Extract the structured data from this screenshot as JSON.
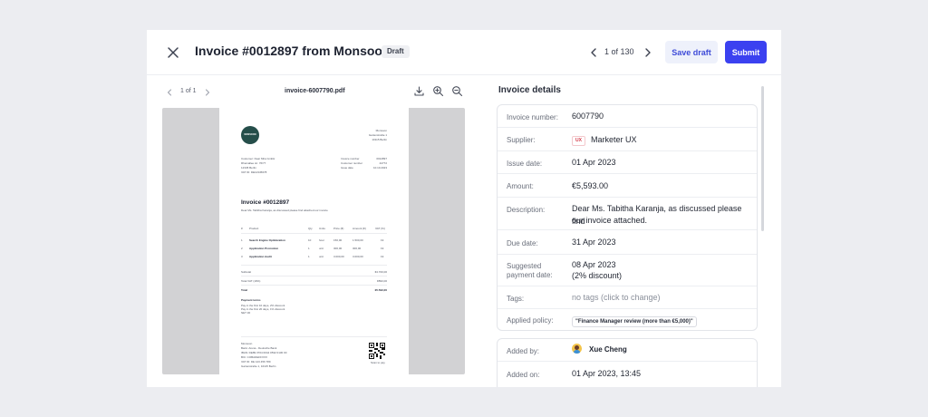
{
  "header": {
    "title": "Invoice #0012897 from Monsoon",
    "badge": "Draft",
    "pager": "1 of 130",
    "save_label": "Save draft",
    "submit_label": "Submit"
  },
  "viewer": {
    "pages": "1 of 1",
    "filename": "invoice-6007790.pdf"
  },
  "document": {
    "logo_text": "MONSOON",
    "sender": [
      "Monsoon",
      "Gartenstraße 1",
      "10115 Berlin"
    ],
    "customer_lines": [
      "Customer: Dear Mira GmbH",
      "Rheinallee str. 76/77",
      "12345 Berlin",
      "VAT ID: DE12345678"
    ],
    "meta_labels": [
      "Invoice number",
      "Customer number",
      "Issue date"
    ],
    "meta_values": [
      "0012897",
      "42772",
      "10.10.2023"
    ],
    "title": "Invoice #0012897",
    "intro": "Dear Ms. Tabitha Karanja, as discussed please find attached our invoice",
    "columns": [
      "#",
      "Product",
      "Qty",
      "Units",
      "Price (€)",
      "Amount (€)",
      "VAT (%)"
    ],
    "items": [
      [
        "1",
        "Search Engine Optimization",
        "10",
        "hour",
        "150,00",
        "1.500,00",
        "19"
      ],
      [
        "2",
        "Application Promotion",
        "1",
        "unit",
        "300,00",
        "300,00",
        "19"
      ],
      [
        "3",
        "Application Audit",
        "1",
        "unit",
        "3.000,00",
        "3.000,00",
        "19"
      ]
    ],
    "totals": [
      [
        "Subtotal",
        "€4.700,00"
      ],
      [
        "Total VAT (19%)",
        "€893,00"
      ],
      [
        "Total",
        "€5.593,00"
      ]
    ],
    "payment_title": "Payment terms",
    "payment_lines": [
      "Pay in the first 10 days, 2% discount",
      "Pay in the first 20 days, 1% discount",
      "NET 30"
    ],
    "footer_lines": [
      "Monsoon",
      "Bank: Arena - Deutsche Bank",
      "IBAN: DE89 3704 0044 0532 0130 00",
      "BIC: COBADEFFXXX",
      "VAT ID: DE 123 456 789",
      "Gartenstraße 1, 10115 Berlin"
    ],
    "qr_caption": "Scan to pay"
  },
  "details": {
    "title": "Invoice details",
    "invoice_number_label": "Invoice number:",
    "invoice_number": "6007790",
    "supplier_label": "Supplier:",
    "supplier_badge": "UX",
    "supplier": "Marketer UX",
    "issue_date_label": "Issue date:",
    "issue_date": "01 Apr 2023",
    "amount_label": "Amount:",
    "amount": "€5,593.00",
    "description_label": "Description:",
    "description_1": "Dear Ms. Tabitha Karanja, as discussed please find",
    "description_2": "our invoice attached.",
    "due_date_label": "Due date:",
    "due_date": "31 Apr 2023",
    "suggested_label_1": "Suggested",
    "suggested_label_2": "payment date:",
    "suggested_1": "08 Apr 2023",
    "suggested_2": "(2% discount)",
    "tags_label": "Tags:",
    "tags": "no tags (click to change)",
    "policy_label": "Applied policy:",
    "policy": "\"Finance Manager review (more than €5,000)\"",
    "added_by_label": "Added by:",
    "added_by": "Xue Cheng",
    "added_on_label": "Added on:",
    "added_on": "01 Apr 2023, 13:45"
  },
  "colors": {
    "accent": "#3b41f0",
    "draft_bg": "#eef1fb",
    "page_bg": "#ecedf1",
    "logo": "#254e4a"
  },
  "icons": [
    "close-icon",
    "chevron-left-icon",
    "chevron-right-icon",
    "download-icon",
    "zoom-in-icon",
    "zoom-out-icon",
    "qr-code-icon"
  ]
}
